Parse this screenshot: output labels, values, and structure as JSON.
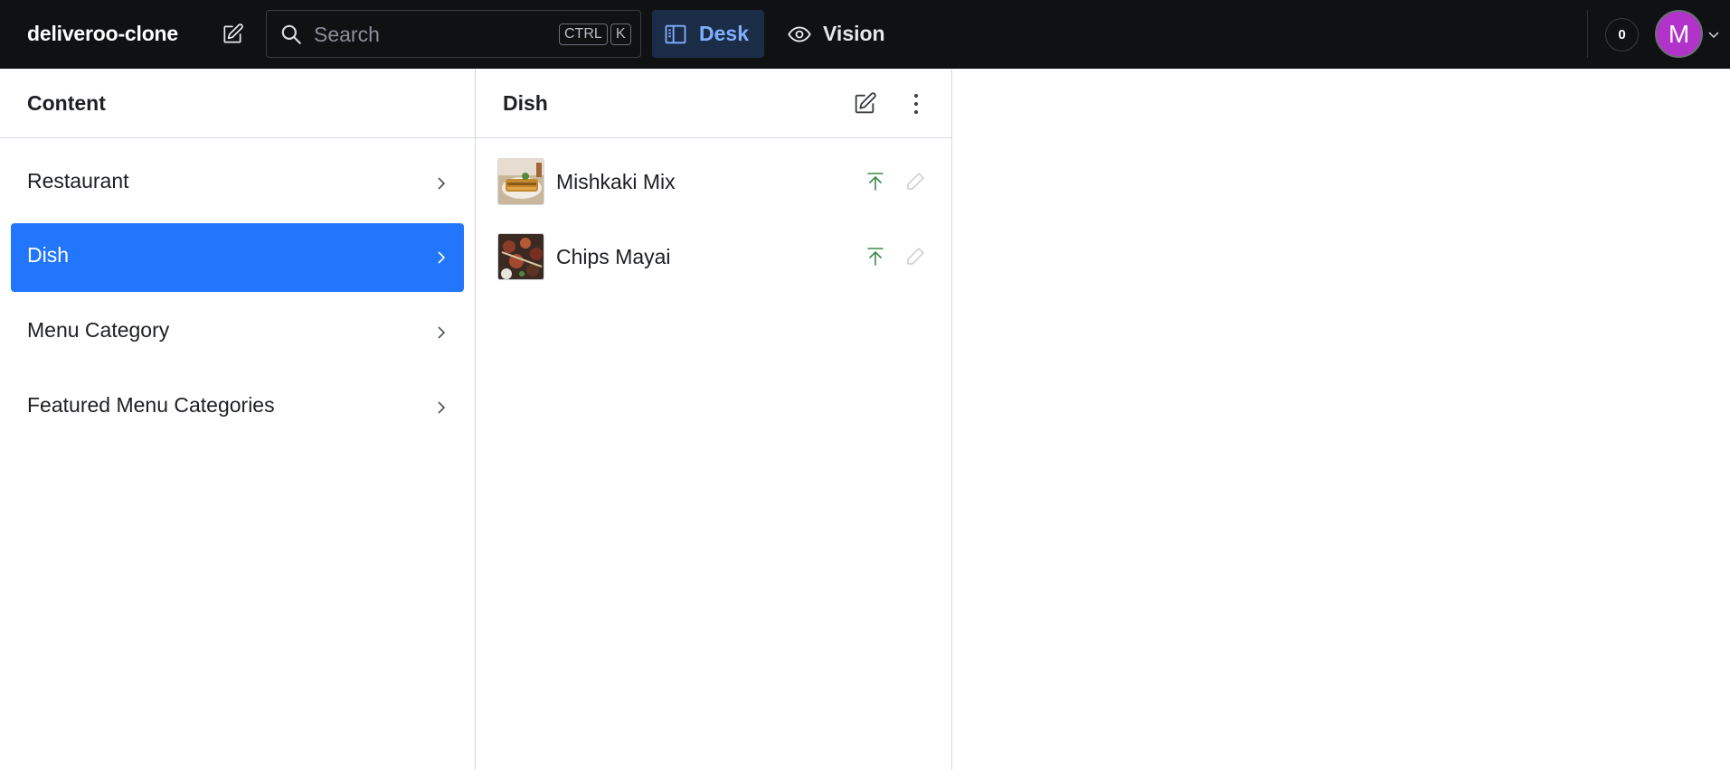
{
  "topbar": {
    "brand": "deliveroo-clone",
    "search_placeholder": "Search",
    "shortcut_ctrl": "CTRL",
    "shortcut_key": "K",
    "tools": [
      {
        "label": "Desk",
        "icon": "desk-icon",
        "active": true
      },
      {
        "label": "Vision",
        "icon": "eye-icon",
        "active": false
      }
    ],
    "notification_count": "0",
    "avatar_initial": "M",
    "avatar_color": "#b233c9"
  },
  "content_pane": {
    "title": "Content",
    "items": [
      {
        "label": "Restaurant",
        "active": false
      },
      {
        "label": "Dish",
        "active": true
      },
      {
        "label": "Menu Category",
        "active": false
      },
      {
        "label": "Featured Menu Categories",
        "active": false
      }
    ]
  },
  "dish_pane": {
    "title": "Dish",
    "documents": [
      {
        "name": "Mishkaki Mix",
        "status": "published"
      },
      {
        "name": "Chips Mayai",
        "status": "published"
      }
    ]
  },
  "colors": {
    "topbar_bg": "#101113",
    "accent": "#2276fc",
    "published": "#3b8a4c"
  }
}
